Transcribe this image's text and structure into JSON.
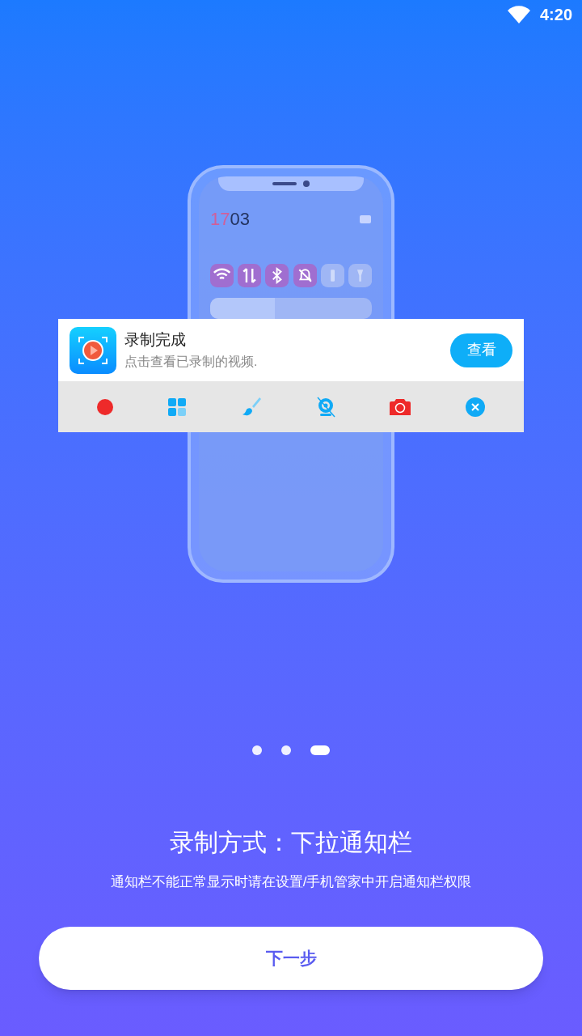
{
  "status_bar": {
    "time": "4:20"
  },
  "illustration": {
    "clock_hour": "17",
    "clock_minute": "03",
    "toggles": [
      {
        "kind": "wifi",
        "on": true
      },
      {
        "kind": "data",
        "on": true
      },
      {
        "kind": "bluetooth",
        "on": true
      },
      {
        "kind": "bell",
        "on": true
      },
      {
        "kind": "battery",
        "on": false
      },
      {
        "kind": "torch",
        "on": false
      }
    ],
    "brightness": {
      "level": 0.4
    }
  },
  "notification": {
    "title": "录制完成",
    "subtitle": "点击查看已录制的视频.",
    "action": "查看",
    "tools": [
      {
        "kind": "record"
      },
      {
        "kind": "grid"
      },
      {
        "kind": "brush"
      },
      {
        "kind": "camera-off"
      },
      {
        "kind": "photo"
      },
      {
        "kind": "close"
      }
    ]
  },
  "pager": [
    {
      "selected": false
    },
    {
      "selected": false
    },
    {
      "selected": true
    }
  ],
  "title": "录制方式：下拉通知栏",
  "subtitle": "通知栏不能正常显示时请在设置/手机管家中开启通知栏权限",
  "next_button": "下一步"
}
